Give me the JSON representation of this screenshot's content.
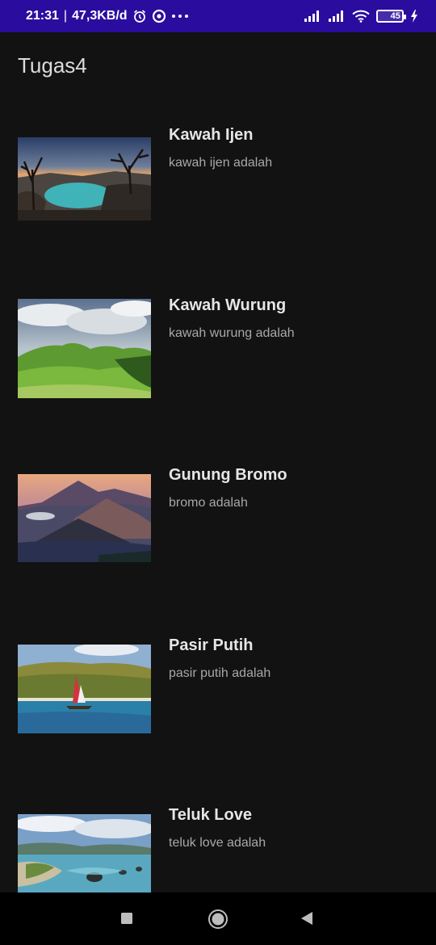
{
  "status_bar": {
    "time": "21:31",
    "separator": "|",
    "network_speed": "47,3KB/d",
    "battery_level": "45",
    "icons": [
      "alarm-icon",
      "sync-icon",
      "more-dots-icon",
      "signal-icon",
      "signal-icon",
      "wifi-icon",
      "battery-icon",
      "charging-icon"
    ]
  },
  "app_bar": {
    "title": "Tugas4"
  },
  "items": [
    {
      "title": "Kawah Ijen",
      "description": "kawah ijen adalah"
    },
    {
      "title": "Kawah Wurung",
      "description": "kawah wurung adalah"
    },
    {
      "title": "Gunung Bromo",
      "description": "bromo adalah"
    },
    {
      "title": "Pasir Putih",
      "description": "pasir putih adalah"
    },
    {
      "title": "Teluk Love",
      "description": "teluk love adalah"
    }
  ],
  "nav_bar": {
    "icons": [
      "recents-square-icon",
      "home-circle-icon",
      "back-triangle-icon"
    ]
  },
  "colors": {
    "status_bar": "#2a0d9e",
    "background": "#121212",
    "title_text": "#e6e6e6",
    "desc_text": "#a8a8a8"
  }
}
